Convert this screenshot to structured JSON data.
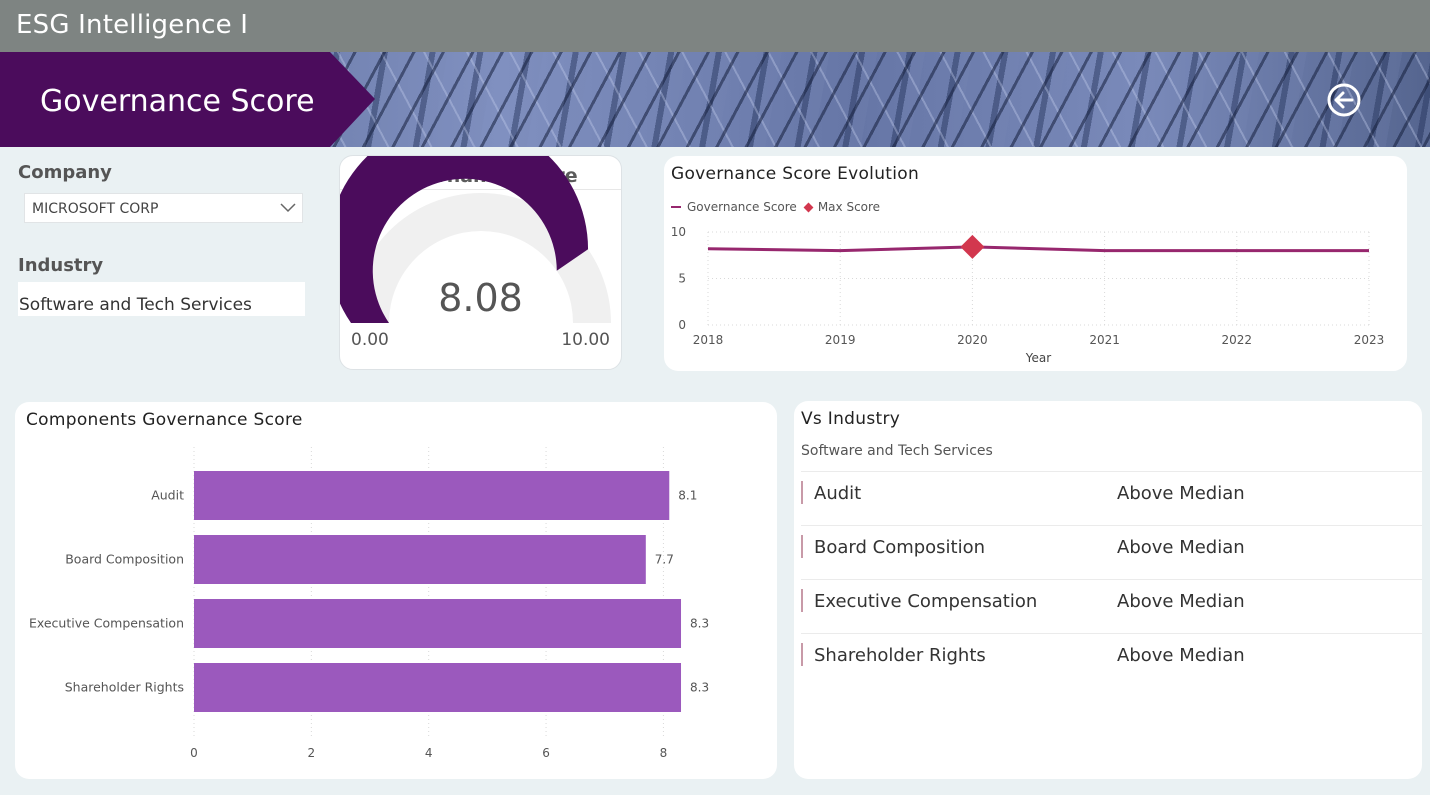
{
  "app": {
    "title": "ESG Intelligence I"
  },
  "banner": {
    "title": "Governance Score"
  },
  "filters": {
    "company_label": "Company",
    "company_value": "MICROSOFT CORP",
    "industry_label": "Industry",
    "industry_value": "Software and Tech Services"
  },
  "gauge": {
    "title": "Governance Score",
    "value": 8.08,
    "value_text": "8.08",
    "min": 0,
    "max": 10,
    "min_text": "0.00",
    "max_text": "10.00",
    "fill_color": "#4b0c5c",
    "track_color": "#f0f0f0"
  },
  "evolution": {
    "title": "Governance Score Evolution",
    "legend_series": "Governance Score",
    "legend_max": "Max Score"
  },
  "components": {
    "title": "Components Governance Score"
  },
  "vs_industry": {
    "title": "Vs Industry",
    "subtitle": "Software and Tech Services",
    "rows": [
      {
        "name": "Audit",
        "status": "Above Median"
      },
      {
        "name": "Board Composition",
        "status": "Above Median"
      },
      {
        "name": "Executive Compensation",
        "status": "Above Median"
      },
      {
        "name": "Shareholder Rights",
        "status": "Above Median"
      }
    ]
  },
  "chart_data": [
    {
      "type": "line",
      "title": "Governance Score Evolution",
      "xlabel": "Year",
      "ylabel": "",
      "x": [
        "2018",
        "2019",
        "2020",
        "2021",
        "2022",
        "2023"
      ],
      "series": [
        {
          "name": "Governance Score",
          "values": [
            8.2,
            8.0,
            8.4,
            8.0,
            8.0,
            8.0
          ],
          "color": "#97276e"
        }
      ],
      "max_marker": {
        "name": "Max Score",
        "x": "2020",
        "value": 8.4,
        "color": "#d2374e"
      },
      "yticks": [
        0,
        5,
        10
      ],
      "ylim": [
        0,
        10
      ],
      "grid": true,
      "legend": "top-left"
    },
    {
      "type": "bar",
      "orientation": "horizontal",
      "title": "Components Governance Score",
      "categories": [
        "Audit",
        "Board Composition",
        "Executive Compensation",
        "Shareholder Rights"
      ],
      "values": [
        8.1,
        7.7,
        8.3,
        8.3
      ],
      "labels": [
        "8.1",
        "7.7",
        "8.3",
        "8.3"
      ],
      "xticks": [
        0,
        2,
        4,
        6,
        8
      ],
      "xlim": [
        0,
        9.7
      ],
      "grid": true,
      "colors": [
        "#9b59bd",
        "#9b59bd",
        "#9b59bd",
        "#9b59bd"
      ]
    }
  ]
}
